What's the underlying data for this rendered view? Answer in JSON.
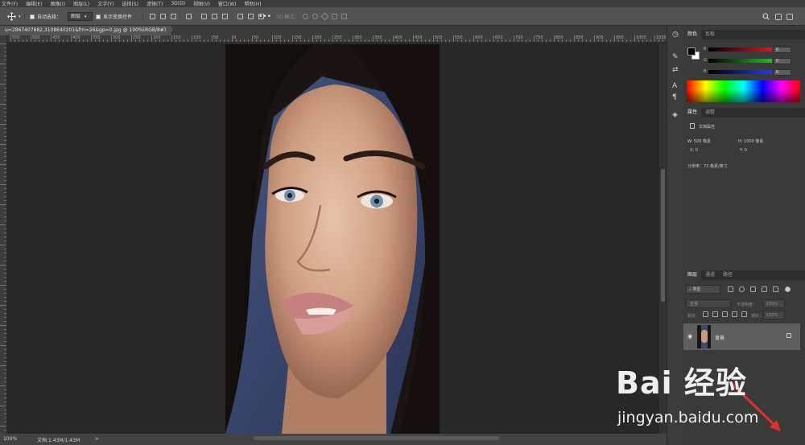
{
  "menu": [
    "文件(F)",
    "编辑(E)",
    "图像(I)",
    "图层(L)",
    "文字(Y)",
    "选择(S)",
    "滤镜(T)",
    "3D(D)",
    "视图(V)",
    "窗口(W)",
    "帮助(H)"
  ],
  "options": {
    "auto_select_label": "自动选择：",
    "auto_select_target": "图层",
    "show_transform_label": "显示变换控件",
    "mode_3d_label": "3D 模式："
  },
  "document": {
    "tab_title": "u=2867407882,3108640201&fm=26&gp=0.jpg @ 100%(RGB/8#)",
    "close_glyph": "×",
    "hruler_labels": [
      "550",
      "500",
      "450",
      "400",
      "350",
      "300",
      "250",
      "200",
      "150",
      "100",
      "50",
      "0",
      "50",
      "100",
      "150",
      "200",
      "250",
      "300",
      "350",
      "400",
      "450",
      "500",
      "550",
      "600",
      "650",
      "700",
      "750",
      "800",
      "850",
      "900",
      "950",
      "1000",
      "1050"
    ]
  },
  "status": {
    "zoom": "100%",
    "doc_size": "文档:1.43M/1.43M",
    "arrow": ">"
  },
  "color_panel": {
    "tabs": [
      "颜色",
      "色板"
    ],
    "channels": [
      {
        "label": "R",
        "value": "0",
        "color": "#d0202a"
      },
      {
        "label": "G",
        "value": "0",
        "color": "#1f9d2a"
      },
      {
        "label": "B",
        "value": "0",
        "color": "#2a3fd0"
      }
    ]
  },
  "properties_panel": {
    "tabs": [
      "属性",
      "调整"
    ],
    "section": "文档属性",
    "width": "W:  500 像素",
    "height": "H:  1000 像素",
    "x": "X:  0",
    "y": "Y:  0",
    "resolution": "分辨率：72 像素/英寸"
  },
  "layers_panel": {
    "tabs": [
      "图层",
      "通道",
      "路径"
    ],
    "filter_kind": "类型",
    "blend_mode": "正常",
    "opacity_label": "不透明度：",
    "opacity_value": "100%",
    "lock_label": "锁定：",
    "fill_label": "填充：",
    "fill_value": "100%",
    "layer_name": "背景"
  },
  "watermark": {
    "logo": "Bai 经验",
    "url": "jingyan.baidu.com"
  },
  "colors": {
    "accent_arrow": "#e0302c"
  }
}
